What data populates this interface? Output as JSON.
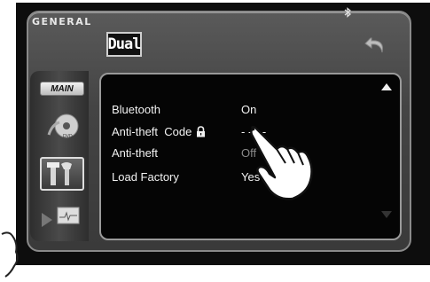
{
  "header": {
    "brand": "GENERAL",
    "logo": "Dual",
    "bluetooth_icon": "bluetooth-icon",
    "back_icon": "back-arrow-icon"
  },
  "sidebar": {
    "main_tab": "MAIN",
    "items": [
      {
        "name": "dvd",
        "icon": "dvd-disc-icon"
      },
      {
        "name": "settings",
        "icon": "settings-tools-icon",
        "selected": true
      },
      {
        "name": "monitor",
        "icon": "monitor-icon"
      }
    ]
  },
  "settings": {
    "rows": [
      {
        "label": "Bluetooth",
        "value": "On"
      },
      {
        "label": "Anti-theft  Code",
        "value": "- - - -",
        "icon": "lock-icon"
      },
      {
        "label": "Anti-theft",
        "value": "Off"
      },
      {
        "label": "Load Factory",
        "value": "Yes"
      }
    ]
  },
  "colors": {
    "frame": "#444444",
    "panel": "#050505",
    "text": "#f2f2f2",
    "accent_border": "#9a9a9a"
  }
}
